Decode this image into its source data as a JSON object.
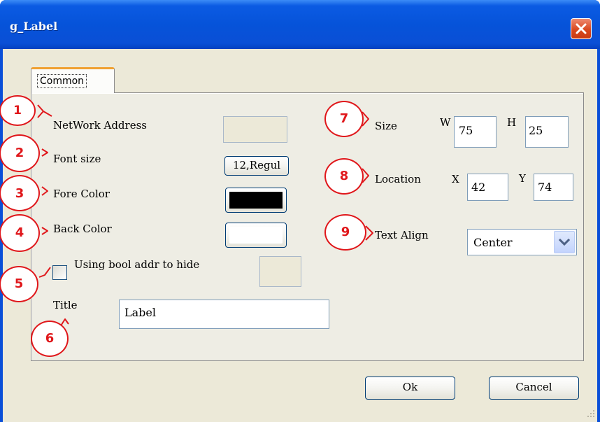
{
  "window": {
    "title": "g_Label",
    "close_icon": "close-icon"
  },
  "tabs": [
    {
      "label": "Common",
      "selected": true
    }
  ],
  "left_panel": {
    "network_address": {
      "label": "NetWork Address",
      "value": ""
    },
    "font_size": {
      "label": "Font size",
      "button_label": "12,Regul"
    },
    "fore_color": {
      "label": "Fore Color",
      "color": "#000000"
    },
    "back_color": {
      "label": "Back Color",
      "color": "#ffffff"
    },
    "hide_option": {
      "label": "Using bool addr to hide",
      "checked": false,
      "value": ""
    },
    "title": {
      "label": "Title",
      "value": "Label"
    }
  },
  "right_panel": {
    "size": {
      "label": "Size",
      "w_label": "W",
      "w_value": "75",
      "h_label": "H",
      "h_value": "25"
    },
    "location": {
      "label": "Location",
      "x_label": "X",
      "x_value": "42",
      "y_label": "Y",
      "y_value": "74"
    },
    "text_align": {
      "label": "Text Align",
      "selected": "Center"
    }
  },
  "footer": {
    "ok_label": "Ok",
    "cancel_label": "Cancel"
  },
  "callouts": [
    "1",
    "2",
    "3",
    "4",
    "5",
    "6",
    "7",
    "8",
    "9"
  ],
  "colors": {
    "titlebar": "#0653d9",
    "dialog_face": "#ece9d8",
    "callout": "#e0171b",
    "tab_highlight": "#f0a030"
  }
}
